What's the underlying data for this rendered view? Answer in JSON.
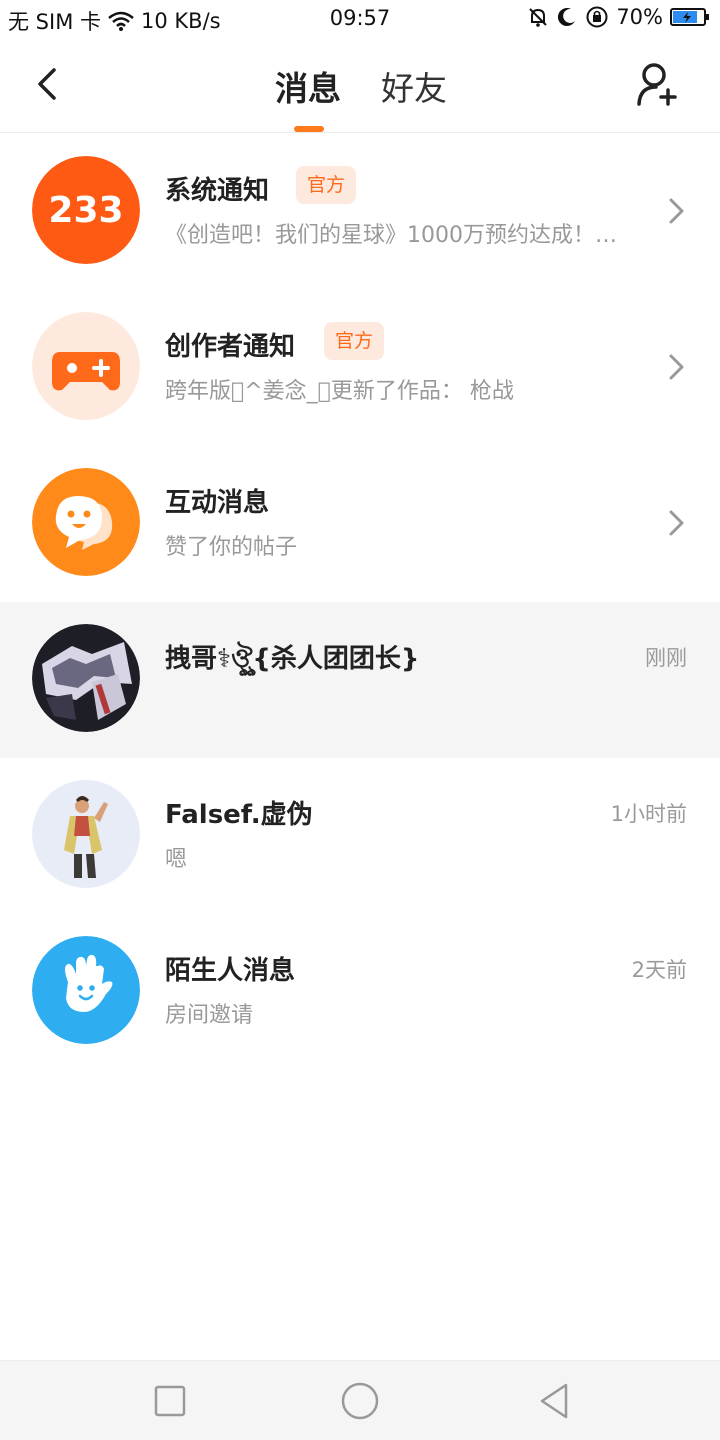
{
  "status_bar": {
    "carrier": "无 SIM 卡",
    "net_speed": "10 KB/s",
    "time": "09:57",
    "battery": "70%"
  },
  "nav": {
    "tab_messages": "消息",
    "tab_friends": "好友",
    "accent_color": "#ff7a1a"
  },
  "items": [
    {
      "title": "系统通知",
      "badge": "官方",
      "subtitle": "《创造吧！我们的星球》1000万预约达成！…",
      "avatar_text": "233",
      "avatar_color": "#ff5a14"
    },
    {
      "title": "创作者通知",
      "badge": "官方",
      "subtitle": "跨年版\u0000^姜念_\u0000更新了作品：  枪战",
      "avatar_color": "#ff6a1a"
    },
    {
      "title": "互动消息",
      "subtitle": "赞了你的帖子",
      "avatar_color": "#ff8a1a"
    },
    {
      "title": "拽哥⚕ঔৣ\u0000{杀人团团长}",
      "time": "刚刚"
    },
    {
      "title": "Falsef.虚伪",
      "subtitle": "嗯",
      "time": "1小时前"
    },
    {
      "title": "陌生人消息",
      "subtitle": "房间邀请",
      "time": "2天前",
      "avatar_color": "#2eaef0"
    }
  ],
  "icons": {
    "back": "chevron-left-icon",
    "add_friend": "add-person-icon",
    "row_chevron": "chevron-right-icon"
  }
}
